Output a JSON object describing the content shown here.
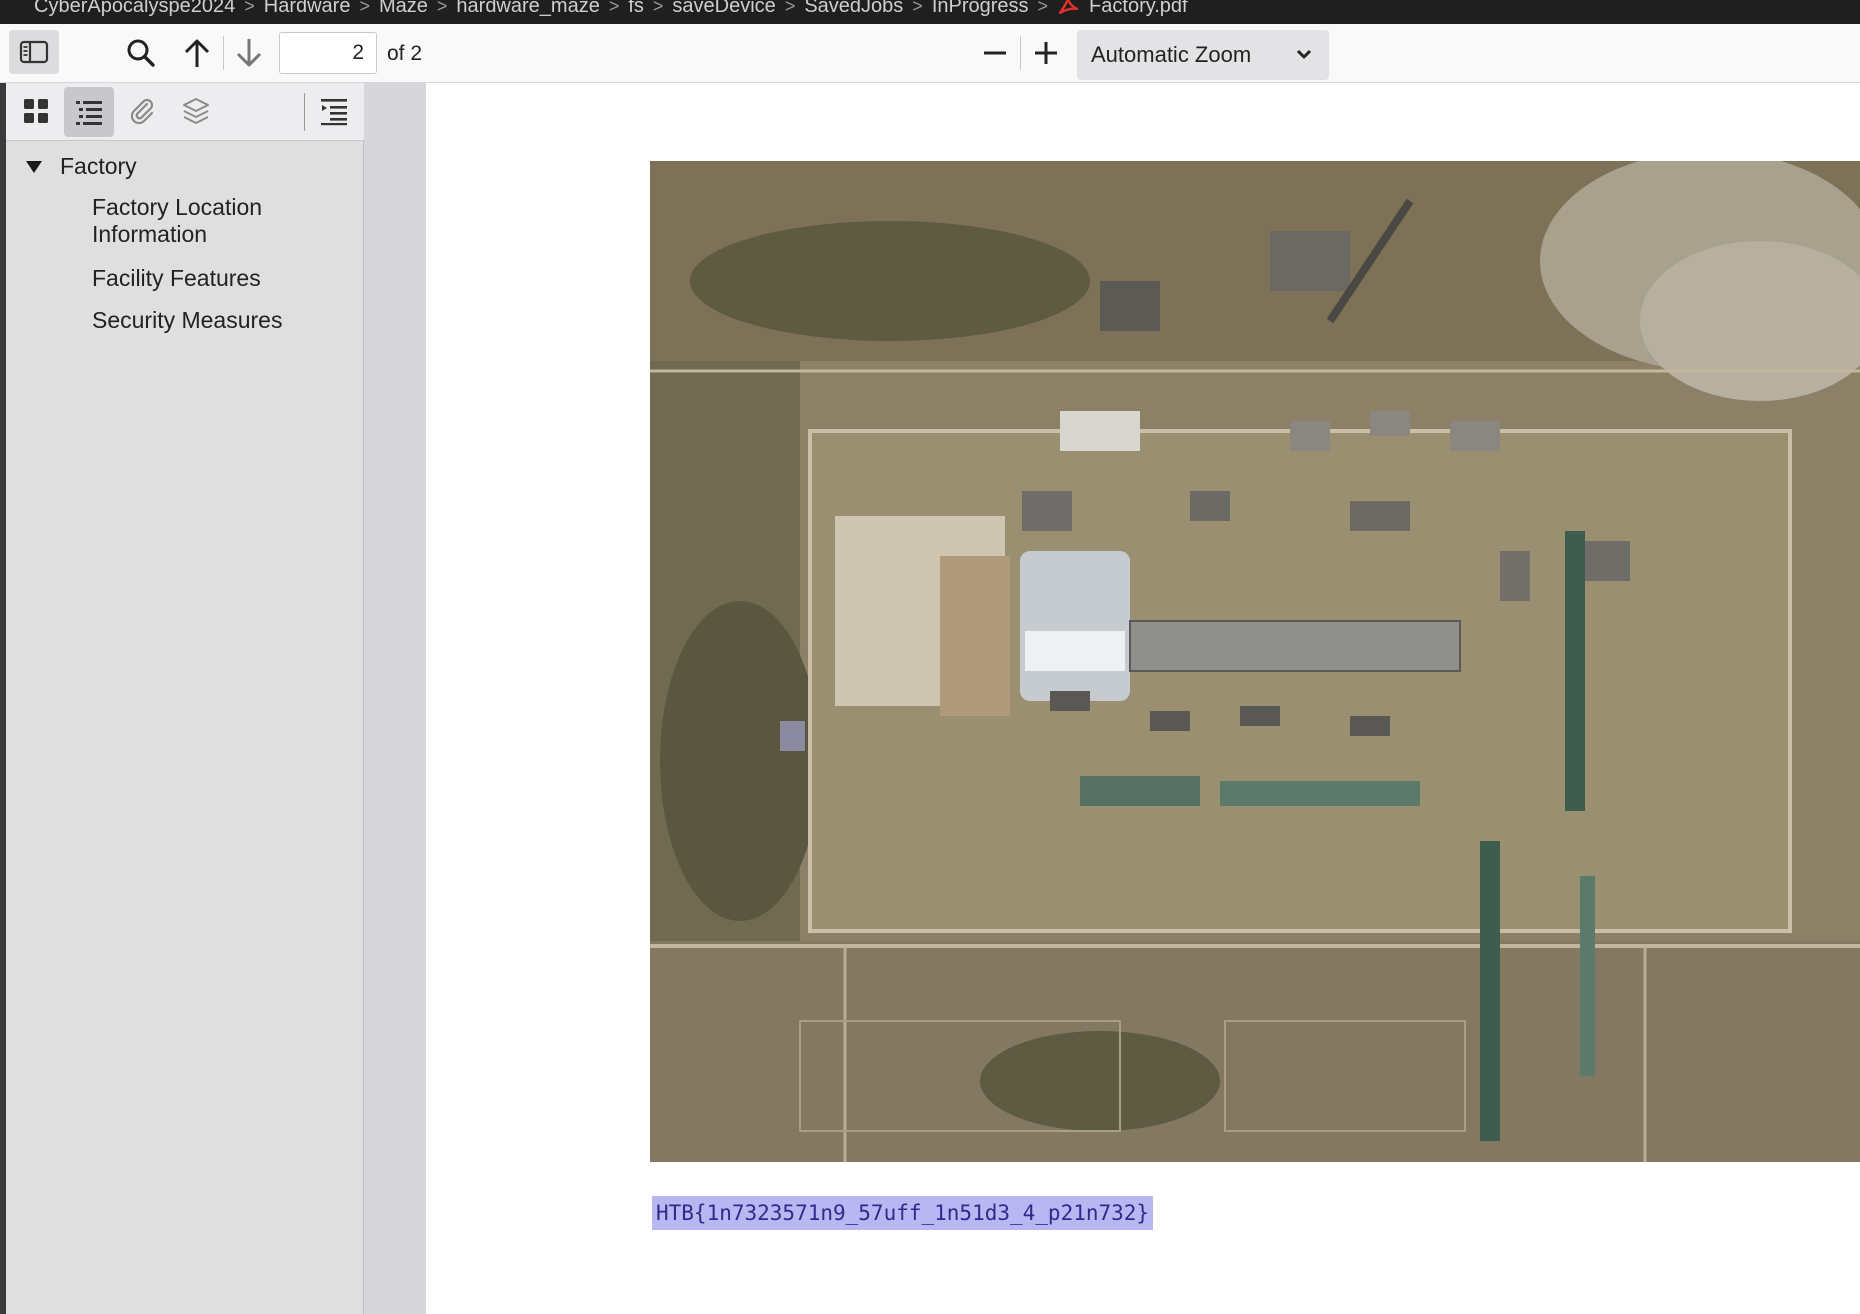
{
  "breadcrumb": {
    "items": [
      "CyberApocalyspe2024",
      "Hardware",
      "Maze",
      "hardware_maze",
      "fs",
      "saveDevice",
      "SavedJobs",
      "InProgress"
    ],
    "file": "Factory.pdf",
    "separator": ">"
  },
  "toolbar": {
    "icons": [
      "sidebar-toggle-icon",
      "search-icon",
      "arrow-up-icon",
      "arrow-down-icon",
      "minus-icon",
      "plus-icon"
    ],
    "page_number": "2",
    "page_count": "of 2",
    "zoom": "Automatic Zoom"
  },
  "sidebar": {
    "view_icons": [
      "thumbnails-icon",
      "outline-icon",
      "attachments-icon",
      "layers-icon",
      "current-outline-item-icon"
    ],
    "outline": {
      "root": "Factory",
      "items": [
        "Factory Location Information",
        "Facility Features",
        "Security Measures"
      ]
    }
  },
  "document": {
    "image": "satellite image of industrial facility",
    "flag": "HTB{1n7323571n9_57uff_1n51d3_4_p21n732}"
  },
  "colors": {
    "highlight": "#b9b7f2",
    "toolbar_bg": "#f9f9fa",
    "sidebar_bg": "#dfdfdf",
    "breadcrumb_bg": "#1f1f1f"
  }
}
